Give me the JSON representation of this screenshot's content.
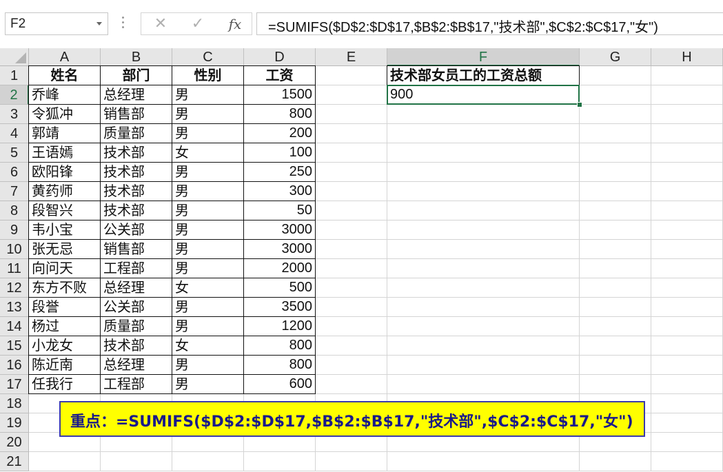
{
  "name_box": "F2",
  "formula_bar": {
    "cancel_icon": "✕",
    "enter_icon": "✓",
    "fx_label": "fx",
    "formula": "=SUMIFS($D$2:$D$17,$B$2:$B$17,\"技术部\",$C$2:$C$17,\"女\")"
  },
  "columns": [
    "A",
    "B",
    "C",
    "D",
    "E",
    "F",
    "G",
    "H"
  ],
  "rows": [
    "1",
    "2",
    "3",
    "4",
    "5",
    "6",
    "7",
    "8",
    "9",
    "10",
    "11",
    "12",
    "13",
    "14",
    "15",
    "16",
    "17",
    "18",
    "19",
    "20",
    "21"
  ],
  "table": {
    "headers": [
      "姓名",
      "部门",
      "性别",
      "工资"
    ],
    "records": [
      [
        "乔峰",
        "总经理",
        "男",
        "1500"
      ],
      [
        "令狐冲",
        "销售部",
        "男",
        "800"
      ],
      [
        "郭靖",
        "质量部",
        "男",
        "200"
      ],
      [
        "王语嫣",
        "技术部",
        "女",
        "100"
      ],
      [
        "欧阳锋",
        "技术部",
        "男",
        "250"
      ],
      [
        "黄药师",
        "技术部",
        "男",
        "300"
      ],
      [
        "段智兴",
        "技术部",
        "男",
        "50"
      ],
      [
        "韦小宝",
        "公关部",
        "男",
        "3000"
      ],
      [
        "张无忌",
        "销售部",
        "男",
        "3000"
      ],
      [
        "向问天",
        "工程部",
        "男",
        "2000"
      ],
      [
        "东方不败",
        "总经理",
        "女",
        "500"
      ],
      [
        "段誉",
        "公关部",
        "男",
        "3500"
      ],
      [
        "杨过",
        "质量部",
        "男",
        "1200"
      ],
      [
        "小龙女",
        "技术部",
        "女",
        "800"
      ],
      [
        "陈近南",
        "总经理",
        "男",
        "800"
      ],
      [
        "任我行",
        "工程部",
        "男",
        "600"
      ]
    ]
  },
  "result": {
    "label": "技术部女员工的工资总额",
    "value": "900"
  },
  "note": "重点：=SUMIFS($D$2:$D$17,$B$2:$B$17,\"技术部\",$C$2:$C$17,\"女\")",
  "colors": {
    "accent": "#217346",
    "note_bg": "#ffff00",
    "note_text": "#1a1a8a"
  }
}
